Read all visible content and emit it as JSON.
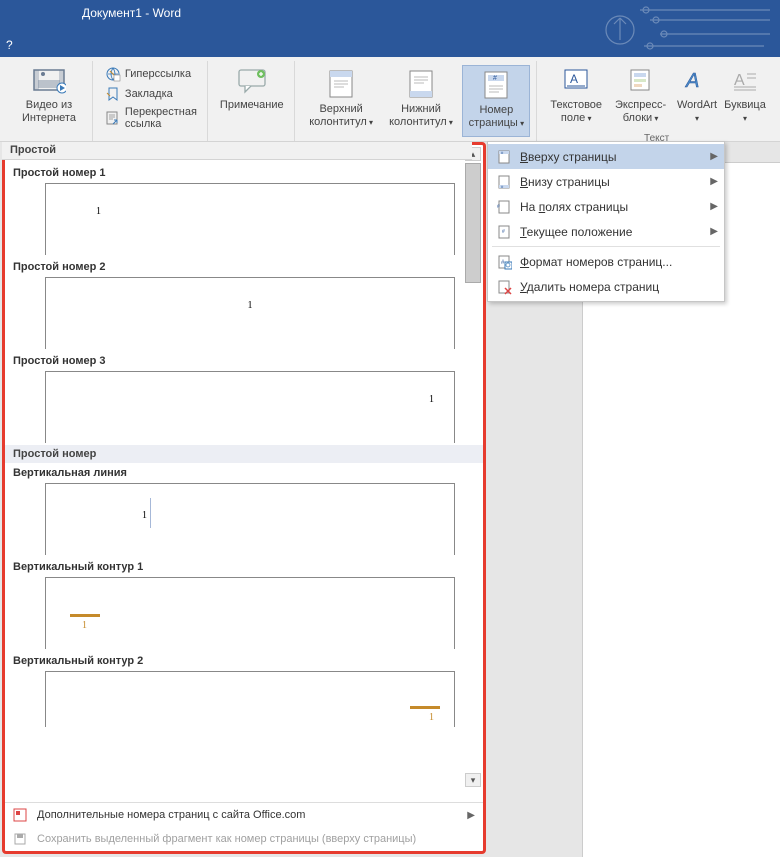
{
  "window": {
    "title": "Документ1 - Word",
    "qat": "?"
  },
  "ribbon": {
    "video": "Видео из Интернета",
    "hyperlink": "Гиперссылка",
    "bookmark": "Закладка",
    "crossref": "Перекрестная ссылка",
    "comment": "Примечание",
    "header": "Верхний колонтитул",
    "footer": "Нижний колонтитул",
    "pagenum": "Номер страницы",
    "textbox": "Текстовое поле",
    "quickparts": "Экспресс-блоки",
    "wordart": "WordArt",
    "dropcap": "Буквица",
    "group_text": "Текст"
  },
  "menu": {
    "top": "Вверху страницы",
    "bottom": "Внизу страницы",
    "margins": "На полях страницы",
    "current": "Текущее положение",
    "format": "Формат номеров страниц...",
    "remove": "Удалить номера страниц"
  },
  "gallery": {
    "header": "Простой",
    "section2": "Простой номер",
    "items": {
      "p1": "Простой номер 1",
      "p2": "Простой номер 2",
      "p3": "Простой номер 3",
      "vline": "Вертикальная линия",
      "vc1": "Вертикальный контур 1",
      "vc2": "Вертикальный контур 2"
    },
    "pagenum_sample": "1",
    "footer_more": "Дополнительные номера страниц с сайта Office.com",
    "footer_save": "Cохранить выделенный фрагмент как номер страницы (вверху страницы)"
  }
}
